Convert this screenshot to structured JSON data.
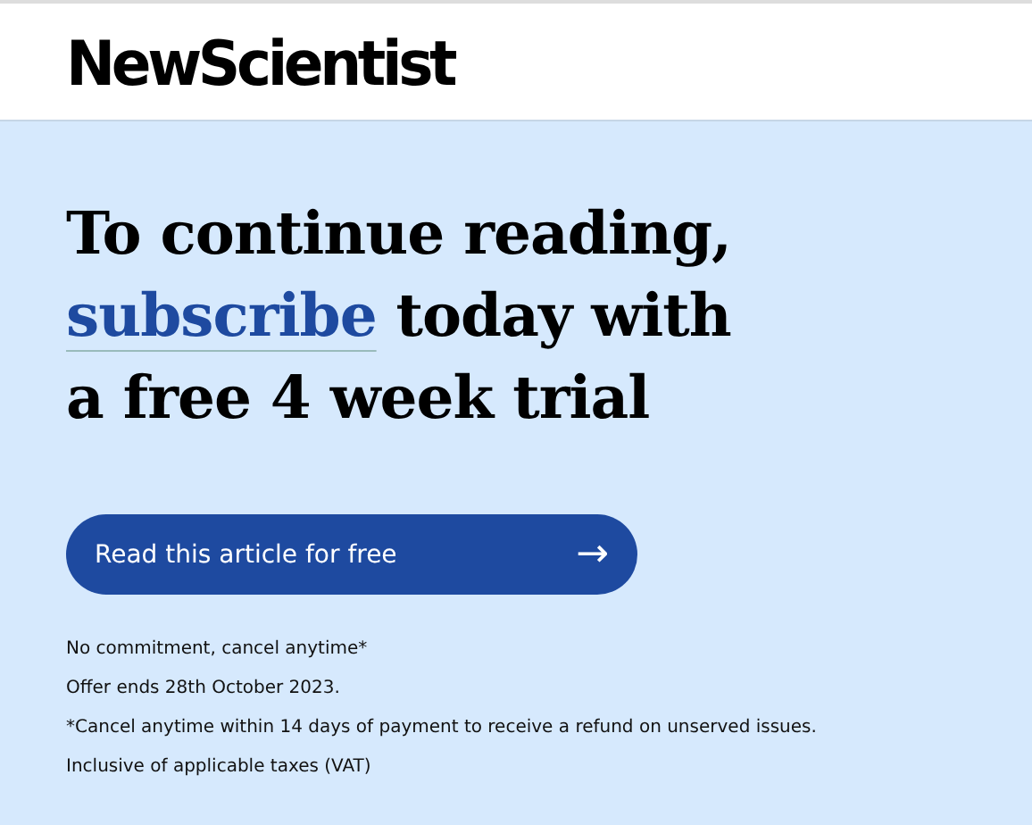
{
  "header": {
    "logo": "NewScientist"
  },
  "headline": {
    "before": "To continue reading,",
    "link": "subscribe",
    "after": "today with a free 4 week trial"
  },
  "cta_button": {
    "label": "Read this article for free",
    "icon": "→"
  },
  "notes": [
    "No commitment, cancel anytime*",
    "Offer ends 28th October 2023.",
    "*Cancel anytime within 14 days of payment to receive a refund on unserved issues.",
    "Inclusive of applicable taxes (VAT)"
  ]
}
